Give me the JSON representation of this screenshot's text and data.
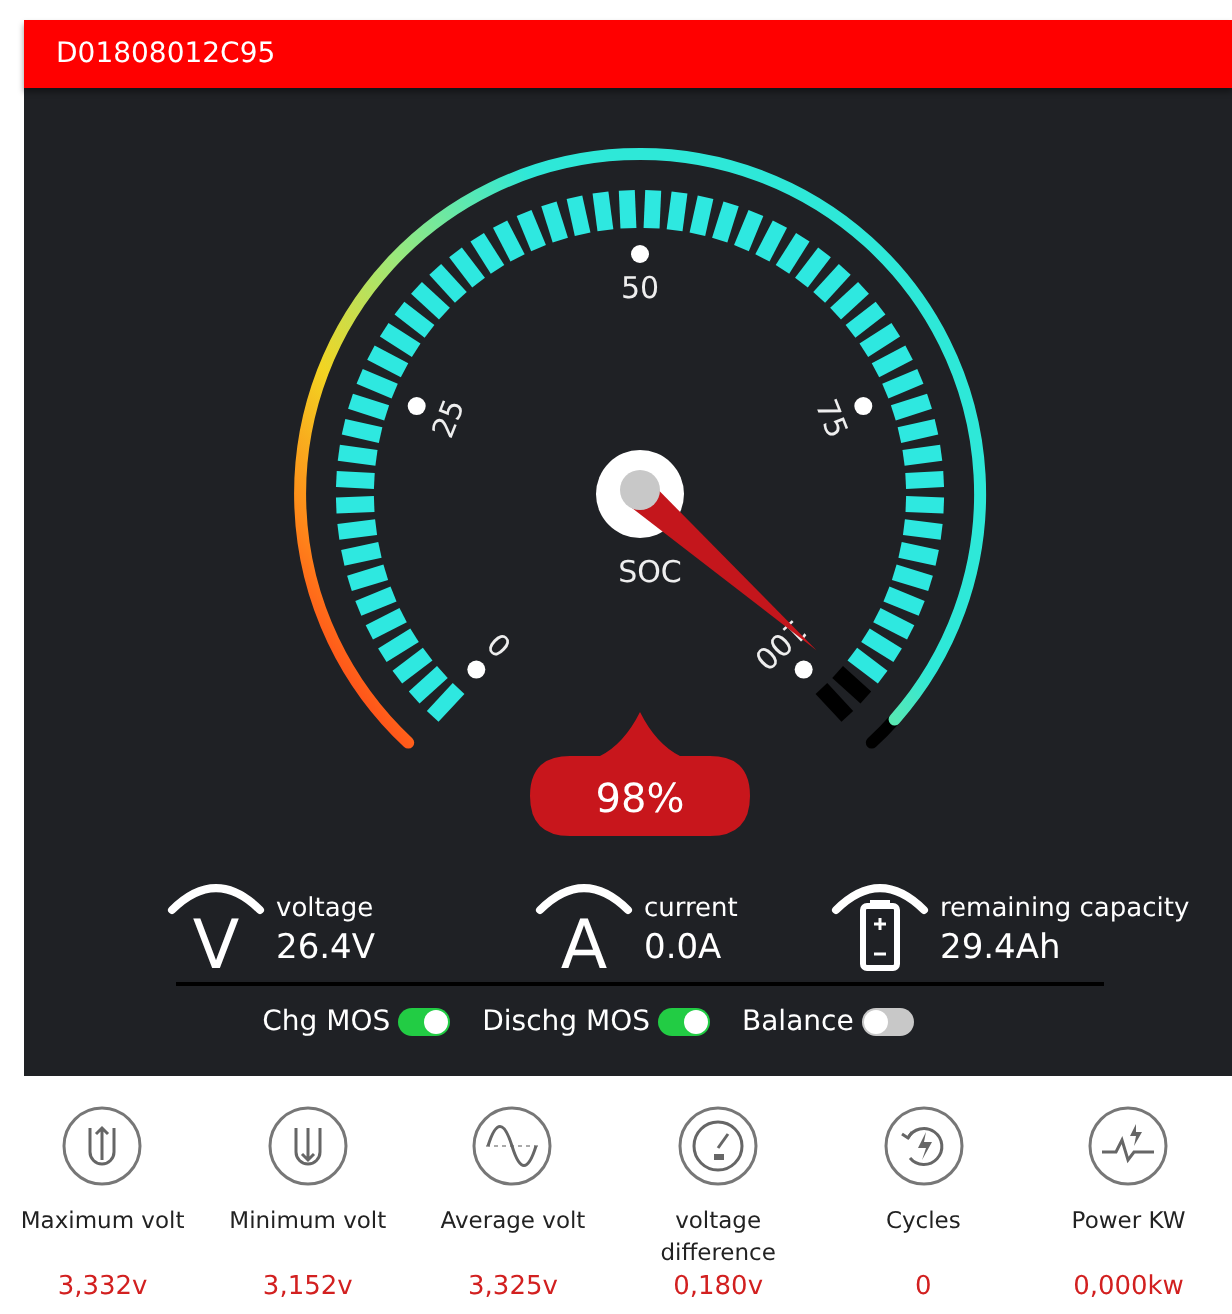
{
  "device_id": "D01808012C95",
  "gauge": {
    "label": "SOC",
    "level": 0.98,
    "value": "98%",
    "scale": [
      "0",
      "25",
      "50",
      "75",
      "100"
    ]
  },
  "readings": [
    {
      "kind": "voltage",
      "symbol": "V",
      "label": "voltage",
      "value": "26.4V"
    },
    {
      "kind": "current",
      "symbol": "A",
      "label": "current",
      "value": "0.0A"
    },
    {
      "kind": "capacity",
      "label": "remaining capacity",
      "value": "29.4Ah"
    }
  ],
  "switches": [
    {
      "label": "Chg MOS",
      "on": true
    },
    {
      "label": "Dischg MOS",
      "on": true
    },
    {
      "label": "Balance",
      "on": false
    }
  ],
  "stats": [
    {
      "kind": "max",
      "label": "Maximum volt",
      "value": "3,332v"
    },
    {
      "kind": "min",
      "label": "Minimum volt",
      "value": "3,152v"
    },
    {
      "kind": "average",
      "label": "Average volt",
      "value": "3,325v"
    },
    {
      "kind": "difference",
      "label": "voltage difference",
      "value": "0,180v"
    },
    {
      "kind": "cycles",
      "label": "Cycles",
      "value": "0"
    },
    {
      "kind": "power",
      "label": "Power KW",
      "value": "0,000kw"
    }
  ]
}
